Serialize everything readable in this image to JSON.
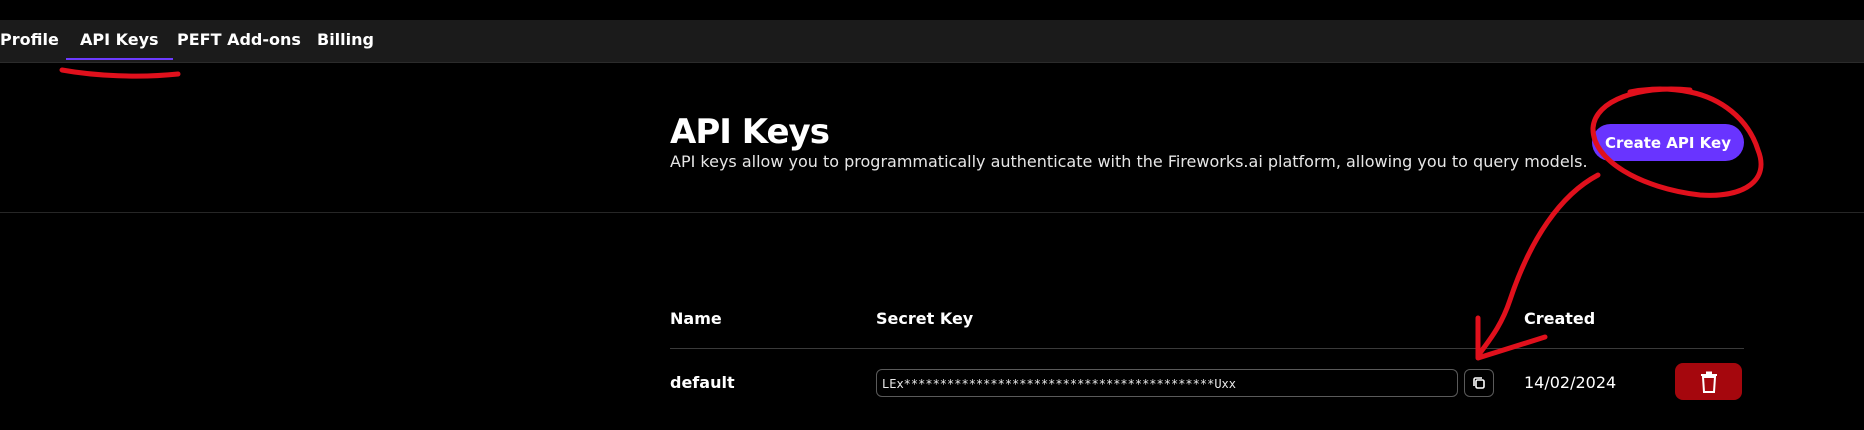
{
  "tabs": [
    {
      "label": "Profile",
      "active": false
    },
    {
      "label": "API Keys",
      "active": true
    },
    {
      "label": "PEFT Add-ons",
      "active": false
    },
    {
      "label": "Billing",
      "active": false
    }
  ],
  "header": {
    "title": "API Keys",
    "description": "API keys allow you to programmatically authenticate with the Fireworks.ai platform, allowing you to query models.",
    "create_button": "Create API Key"
  },
  "table": {
    "columns": [
      "Name",
      "Secret Key",
      "Created"
    ],
    "rows": [
      {
        "name": "default",
        "secret_key": "LEx*******************************************Uxx",
        "created": "14/02/2024"
      }
    ]
  },
  "icons": {
    "copy": "copy-icon",
    "delete": "trash-icon"
  },
  "colors": {
    "accent": "#6934ff",
    "danger": "#a5070d",
    "annotation": "#e0101c"
  }
}
